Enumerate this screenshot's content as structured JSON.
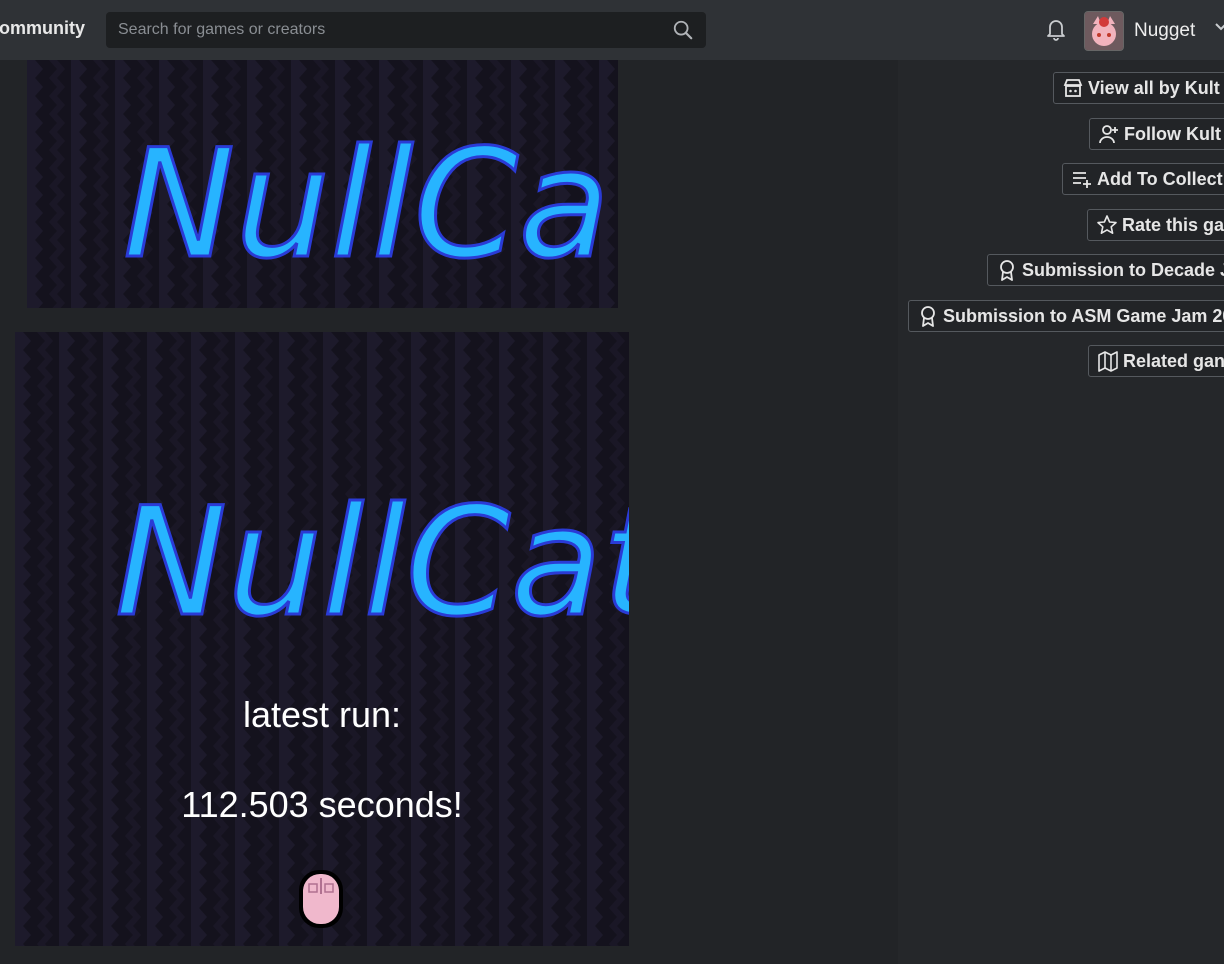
{
  "header": {
    "nav_link": "Community",
    "search_placeholder": "Search for games or creators",
    "username": "Nugget"
  },
  "screenshots": [
    {
      "logo": "NullCat"
    },
    {
      "logo": "NullCat",
      "latest_label": "latest run:",
      "result": "112.503 seconds!"
    }
  ],
  "actions": [
    {
      "label": "View all by Kult",
      "icon": "store-icon"
    },
    {
      "label": "Follow Kult",
      "icon": "follow-user-icon"
    },
    {
      "label": "Add To Collect",
      "icon": "add-to-list-icon"
    },
    {
      "label": "Rate this ga",
      "icon": "star-icon"
    },
    {
      "label": "Submission to Decade J",
      "icon": "award-icon"
    },
    {
      "label": "Submission to ASM Game Jam 20",
      "icon": "award-icon"
    },
    {
      "label": "Related gan",
      "icon": "map-icon"
    }
  ],
  "colors": {
    "topbar": "#2f3236",
    "page_bg": "#222427",
    "logo_fill": "#27b4ff",
    "logo_outline": "#2a3bd6",
    "game_bg": "#14121d"
  }
}
